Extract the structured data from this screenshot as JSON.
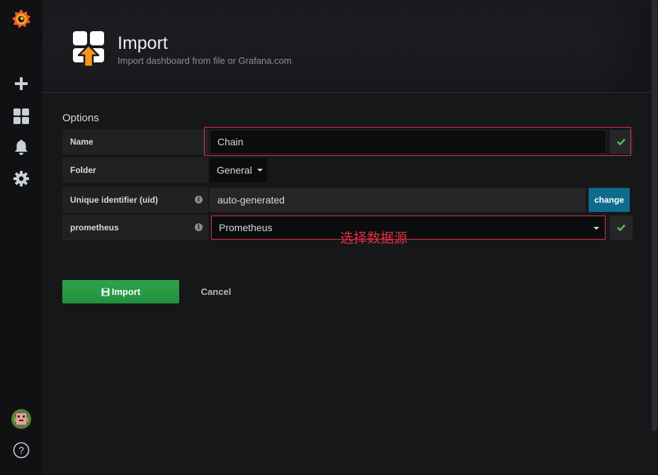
{
  "header": {
    "title": "Import",
    "subtitle": "Import dashboard from file or Grafana.com"
  },
  "options": {
    "section_title": "Options",
    "name_label": "Name",
    "name_value": "Chain",
    "folder_label": "Folder",
    "folder_value": "General",
    "uid_label": "Unique identifier (uid)",
    "uid_value": "auto-generated",
    "uid_change_label": "change",
    "datasource_label": "prometheus",
    "datasource_value": "Prometheus",
    "info_glyph": "i"
  },
  "annotation": {
    "text": "选择数据源"
  },
  "actions": {
    "import_label": "Import",
    "cancel_label": "Cancel"
  },
  "sidebar": {
    "help_glyph": "?"
  },
  "colors": {
    "accent_green": "#299c46",
    "accent_blue": "#0e6b8c",
    "highlight_red": "#e02f44",
    "check_green": "#4ac75c",
    "logo_orange": "#f05a28"
  },
  "icons": [
    "grafana-logo-icon",
    "plus-icon",
    "dashboards-icon",
    "bell-icon",
    "gear-icon",
    "avatar-icon",
    "help-icon",
    "import-icon",
    "info-icon",
    "check-icon",
    "save-icon",
    "chevron-down-icon"
  ]
}
